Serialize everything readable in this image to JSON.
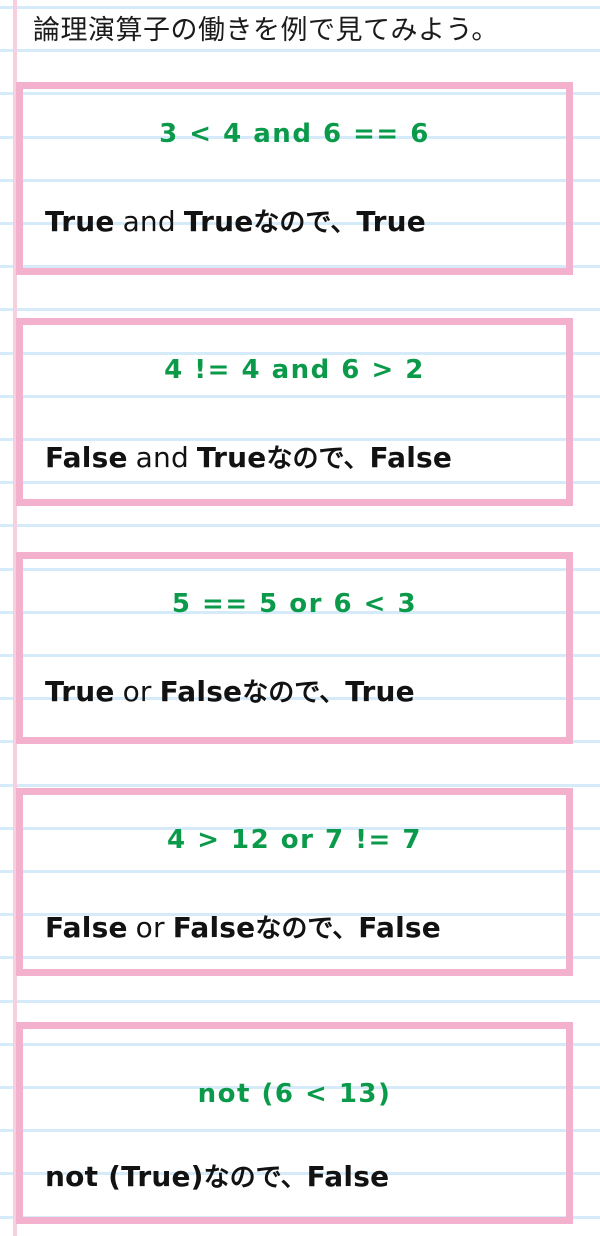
{
  "page": {
    "title": "論理演算子の働きを例で見てみよう。",
    "paper": {
      "rule_color": "#d6ebf9",
      "margin_line_color": "#f9cfe0",
      "background_color": "#ffffff"
    },
    "palette": {
      "box_border": "#f4b1cd",
      "expression_text": "#0a9a4a",
      "result_text": "#121212"
    },
    "connector_text": "なので、"
  },
  "examples": [
    {
      "id": "example-1",
      "expression": "3 < 4 and 6 == 6",
      "left_value": "True",
      "operator": "and",
      "right_value": "True",
      "connector": "なので、",
      "result": "True"
    },
    {
      "id": "example-2",
      "expression": "4 != 4 and 6 > 2",
      "left_value": "False",
      "operator": "and",
      "right_value": "True",
      "connector": "なので、",
      "result": "False"
    },
    {
      "id": "example-3",
      "expression": "5 == 5 or 6 < 3",
      "left_value": "True",
      "operator": "or",
      "right_value": "False",
      "connector": "なので、",
      "result": "True"
    },
    {
      "id": "example-4",
      "expression": "4 > 12 or 7 != 7",
      "left_value": "False",
      "operator": "or",
      "right_value": "False",
      "connector": "なので、",
      "result": "False"
    },
    {
      "id": "example-5",
      "expression": "not (6 < 13)",
      "left_value": "not (True)",
      "operator": "",
      "right_value": "",
      "connector": "なので、",
      "result": "False"
    }
  ]
}
